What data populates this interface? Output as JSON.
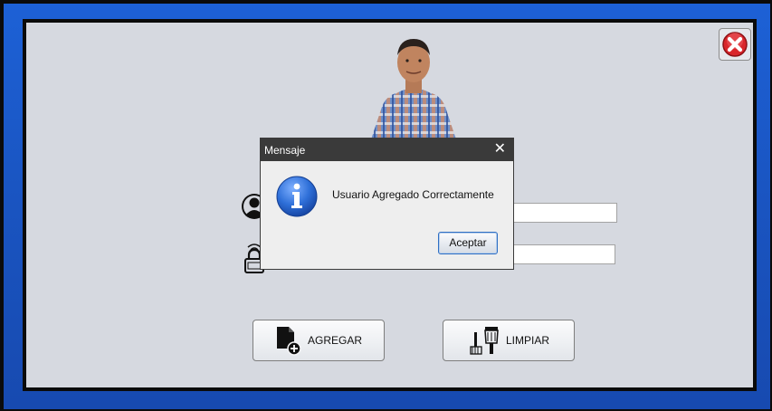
{
  "dialog": {
    "title": "Mensaje",
    "message": "Usuario Agregado Correctamente",
    "ok_label": "Aceptar"
  },
  "form": {
    "username_value": "",
    "password_value": ""
  },
  "buttons": {
    "add_label": "AGREGAR",
    "clear_label": "LIMPIAR"
  },
  "icons": {
    "app_close": "close-x-icon",
    "user": "user-icon",
    "lock": "lock-icon",
    "add": "add-document-icon",
    "clear": "broom-brush-icon",
    "info": "info-icon"
  },
  "colors": {
    "window_border": "#1d61d6",
    "panel": "#d6d9e0",
    "dialog_titlebar": "#3a3a3a",
    "close_red": "#d9262b"
  }
}
